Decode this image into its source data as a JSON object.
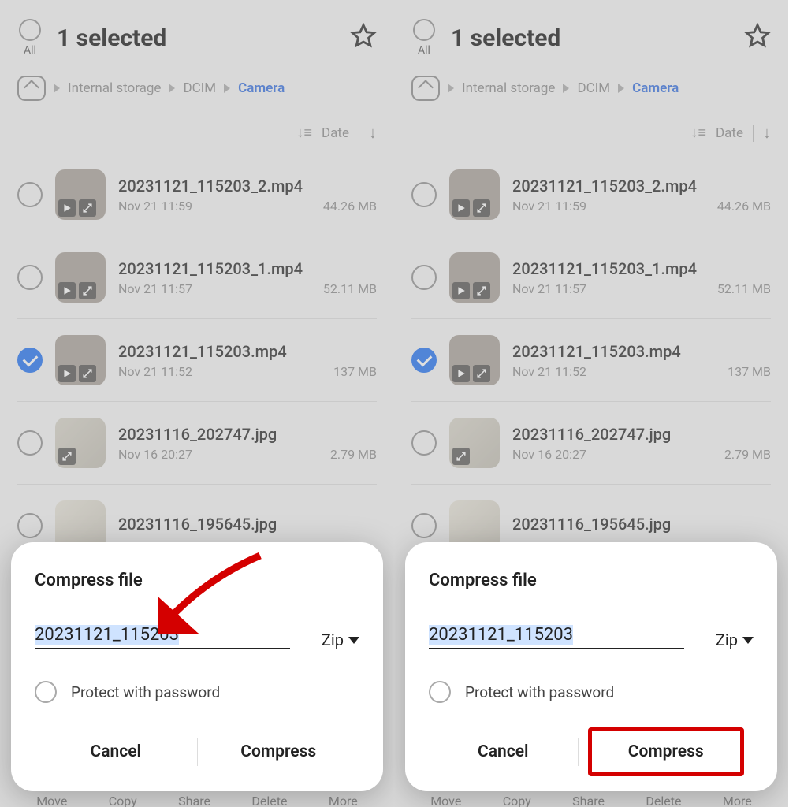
{
  "header": {
    "all_label": "All",
    "title": "1 selected"
  },
  "breadcrumb": {
    "items": [
      "Internal storage",
      "DCIM",
      "Camera"
    ]
  },
  "sort": {
    "label": "Date"
  },
  "files": [
    {
      "name": "20231121_115203_2.mp4",
      "date": "Nov 21 11:59",
      "size": "44.26 MB",
      "type": "video",
      "checked": false
    },
    {
      "name": "20231121_115203_1.mp4",
      "date": "Nov 21 11:57",
      "size": "52.11 MB",
      "type": "video",
      "checked": false
    },
    {
      "name": "20231121_115203.mp4",
      "date": "Nov 21 11:52",
      "size": "137 MB",
      "type": "video",
      "checked": true
    },
    {
      "name": "20231116_202747.jpg",
      "date": "Nov 16 20:27",
      "size": "2.79 MB",
      "type": "photo",
      "checked": false
    },
    {
      "name": "20231116_195645.jpg",
      "date": "",
      "size": "",
      "type": "photo2",
      "checked": false
    }
  ],
  "dialog": {
    "title": "Compress file",
    "filename": "20231121_115203",
    "format": "Zip",
    "protect_label": "Protect with password",
    "cancel": "Cancel",
    "confirm": "Compress"
  },
  "bottom": {
    "actions": [
      "Move",
      "Copy",
      "Share",
      "Delete",
      "More"
    ]
  }
}
